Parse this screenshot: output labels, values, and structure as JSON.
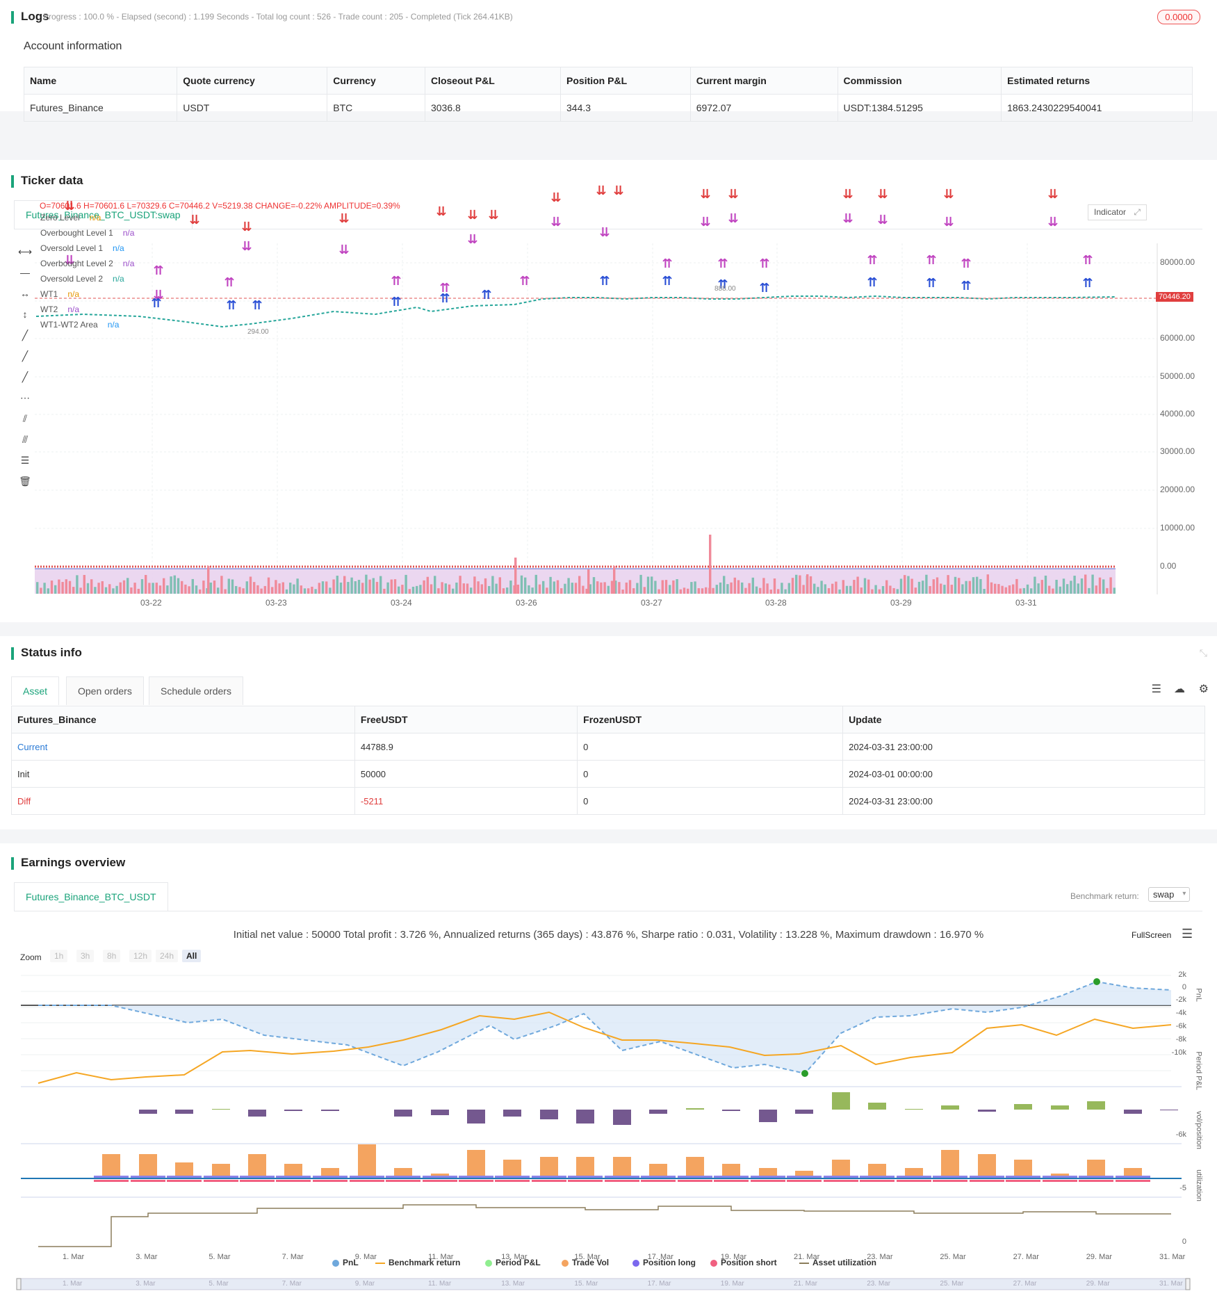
{
  "logs": {
    "title": "Logs",
    "status": "Progress : 100.0 % - Elapsed (second) : 1.199  Seconds - Total log count : 526 - Trade count : 205 - Completed (Tick 264.41KB)",
    "badge": "0.0000"
  },
  "account": {
    "title": "Account information",
    "headers": [
      "Name",
      "Quote currency",
      "Currency",
      "Closeout P&L",
      "Position P&L",
      "Current margin",
      "Commission",
      "Estimated returns"
    ],
    "row": [
      "Futures_Binance",
      "USDT",
      "BTC",
      "3036.8",
      "344.3",
      "6972.07",
      "USDT:1384.51295",
      "1863.2430229540041"
    ]
  },
  "ticker": {
    "title": "Ticker data",
    "tab": "Futures_Binance_BTC_USDT:swap",
    "ohlc": "O=70601.6 H=70601.6 L=70329.6 C=70446.2 V=5219.38 CHANGE=-0.22% AMPLITUDE=0.39%",
    "indicator_button": "Indicator",
    "price_tag": "70446.20",
    "legend": [
      {
        "name": "Zero Level",
        "value": "n/a",
        "color": "#e69500"
      },
      {
        "name": "Overbought Level 1",
        "value": "n/a",
        "color": "#9b4dca"
      },
      {
        "name": "Oversold Level 1",
        "value": "n/a",
        "color": "#2196f3"
      },
      {
        "name": "Overbought Level 2",
        "value": "n/a",
        "color": "#9b4dca"
      },
      {
        "name": "Oversold Level 2",
        "value": "n/a",
        "color": "#26a69a"
      },
      {
        "name": "WT1",
        "value": "n/a",
        "color": "#e69500"
      },
      {
        "name": "WT2",
        "value": "n/a",
        "color": "#9b4dca"
      },
      {
        "name": "WT1-WT2 Area",
        "value": "n/a",
        "color": "#2196f3"
      }
    ],
    "y_ticks": [
      "80000.00",
      "70000.00",
      "60000.00",
      "50000.00",
      "40000.00",
      "30000.00",
      "20000.00",
      "10000.00",
      "0.00"
    ],
    "x_ticks": [
      "03-22",
      "03-23",
      "03-24",
      "03-26",
      "03-27",
      "03-28",
      "03-29",
      "03-31"
    ],
    "annotations": [
      "294.00",
      "888.00"
    ]
  },
  "status": {
    "title": "Status info",
    "tabs": [
      "Asset",
      "Open orders",
      "Schedule orders"
    ],
    "headers": [
      "Futures_Binance",
      "FreeUSDT",
      "FrozenUSDT",
      "Update"
    ],
    "rows": [
      [
        "Current",
        "44788.9",
        "0",
        "2024-03-31 23:00:00"
      ],
      [
        "Init",
        "50000",
        "0",
        "2024-03-01 00:00:00"
      ],
      [
        "Diff",
        "-5211",
        "0",
        "2024-03-31 23:00:00"
      ]
    ]
  },
  "earnings": {
    "title": "Earnings overview",
    "tab": "Futures_Binance_BTC_USDT",
    "benchmark_label": "Benchmark return:",
    "benchmark_value": "swap",
    "summary": "Initial net value : 50000 Total profit : 3.726 %, Annualized returns (365 days) : 43.876 %, Sharpe ratio : 0.031, Volatility : 13.228 %, Maximum drawdown : 16.970 %",
    "fullscreen": "FullScreen",
    "zoom_label": "Zoom",
    "zoom_options": [
      "1h",
      "3h",
      "8h",
      "12h",
      "24h",
      "All"
    ],
    "pnl_ticks": [
      "2k",
      "0",
      "-2k",
      "-4k",
      "-6k",
      "-8k",
      "-10k"
    ],
    "period_ticks": [
      "-6k"
    ],
    "vol_ticks": [
      "-5"
    ],
    "util_ticks": [
      "0"
    ],
    "axis_titles": [
      "PnL",
      "Period P&L",
      "vol/position",
      "utilization"
    ],
    "x_ticks": [
      "1. Mar",
      "3. Mar",
      "5. Mar",
      "7. Mar",
      "9. Mar",
      "11. Mar",
      "13. Mar",
      "15. Mar",
      "17. Mar",
      "19. Mar",
      "21. Mar",
      "23. Mar",
      "25. Mar",
      "27. Mar",
      "29. Mar",
      "31. Mar"
    ],
    "legend": [
      {
        "name": "PnL",
        "color": "#6fa8dc"
      },
      {
        "name": "Benchmark return",
        "color": "#f5a623"
      },
      {
        "name": "Period P&L",
        "color": "#90ee90"
      },
      {
        "name": "Trade Vol",
        "color": "#f4a460"
      },
      {
        "name": "Position long",
        "color": "#7b68ee"
      },
      {
        "name": "Position short",
        "color": "#f06080"
      },
      {
        "name": "Asset utilization",
        "color": "#8b7d5b"
      }
    ]
  }
}
